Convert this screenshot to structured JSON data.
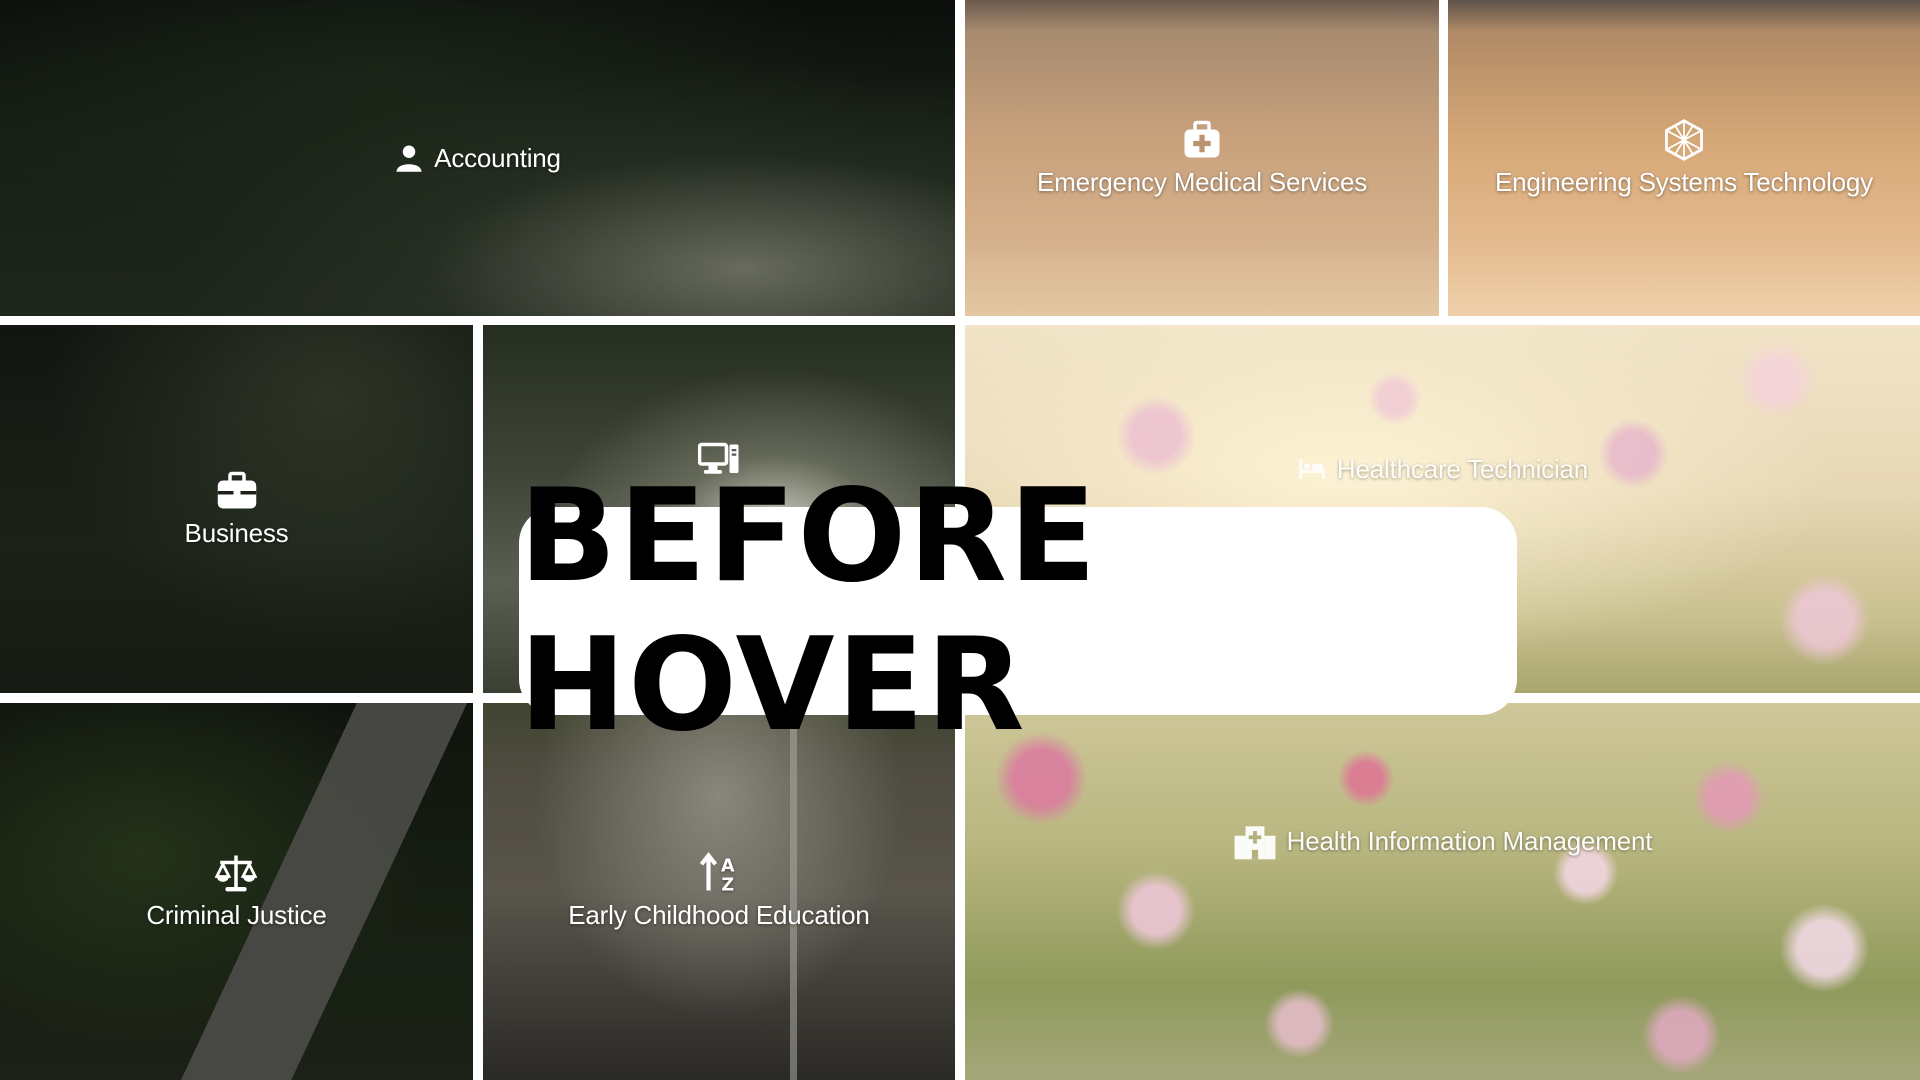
{
  "tiles": [
    {
      "id": "accounting",
      "label": "Accounting",
      "icon": "user-icon"
    },
    {
      "id": "ems",
      "label": "Emergency Medical Services",
      "icon": "first-aid-kit-icon"
    },
    {
      "id": "eng",
      "label": "Engineering Systems Technology",
      "icon": "hexagon-pattern-icon"
    },
    {
      "id": "business",
      "label": "Business",
      "icon": "briefcase-icon"
    },
    {
      "id": "cit",
      "label": "",
      "icon": "desktop-computer-icon"
    },
    {
      "id": "healthcare",
      "label": "Healthcare Technician",
      "icon": "hospital-bed-icon"
    },
    {
      "id": "criminal",
      "label": "Criminal Justice",
      "icon": "scales-icon"
    },
    {
      "id": "early",
      "label": "Early Childhood Education",
      "icon": "sort-a-z-icon"
    },
    {
      "id": "him",
      "label": "Health Information Management",
      "icon": "hospital-building-icon"
    }
  ],
  "banner": {
    "text": "BEFORE HOVER"
  }
}
